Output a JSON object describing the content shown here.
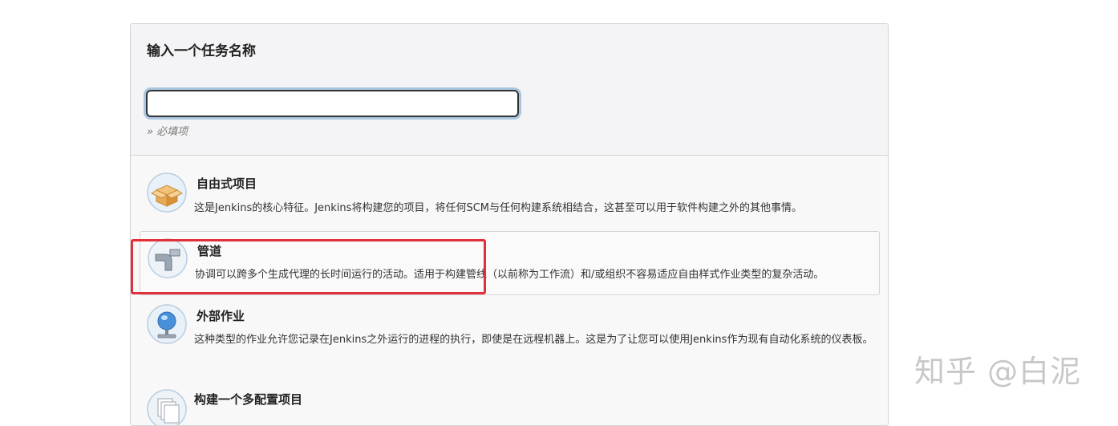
{
  "form": {
    "name_label": "输入一个任务名称",
    "name_value": "",
    "required_hint": "» 必填项"
  },
  "items": [
    {
      "icon": "freestyle-box-icon",
      "title": "自由式项目",
      "description": "这是Jenkins的核心特征。Jenkins将构建您的项目，将任何SCM与任何构建系统相结合，这甚至可以用于软件构建之外的其他事情。"
    },
    {
      "icon": "pipeline-pipe-icon",
      "title": "管道",
      "description": "协调可以跨多个生成代理的长时间运行的活动。适用于构建管线（以前称为工作流）和/或组织不容易适应自由样式作业类型的复杂活动。"
    },
    {
      "icon": "external-job-monitor-icon",
      "title": "外部作业",
      "description": "这种类型的作业允许您记录在Jenkins之外运行的进程的执行，即使是在远程机器上。这是为了让您可以使用Jenkins作为现有自动化系统的仪表板。"
    },
    {
      "icon": "multi-config-icon",
      "title": "构建一个多配置项目",
      "description": ""
    }
  ],
  "annotation": {
    "highlight_color": "#e0303a"
  },
  "watermark": "知乎 @白泥"
}
